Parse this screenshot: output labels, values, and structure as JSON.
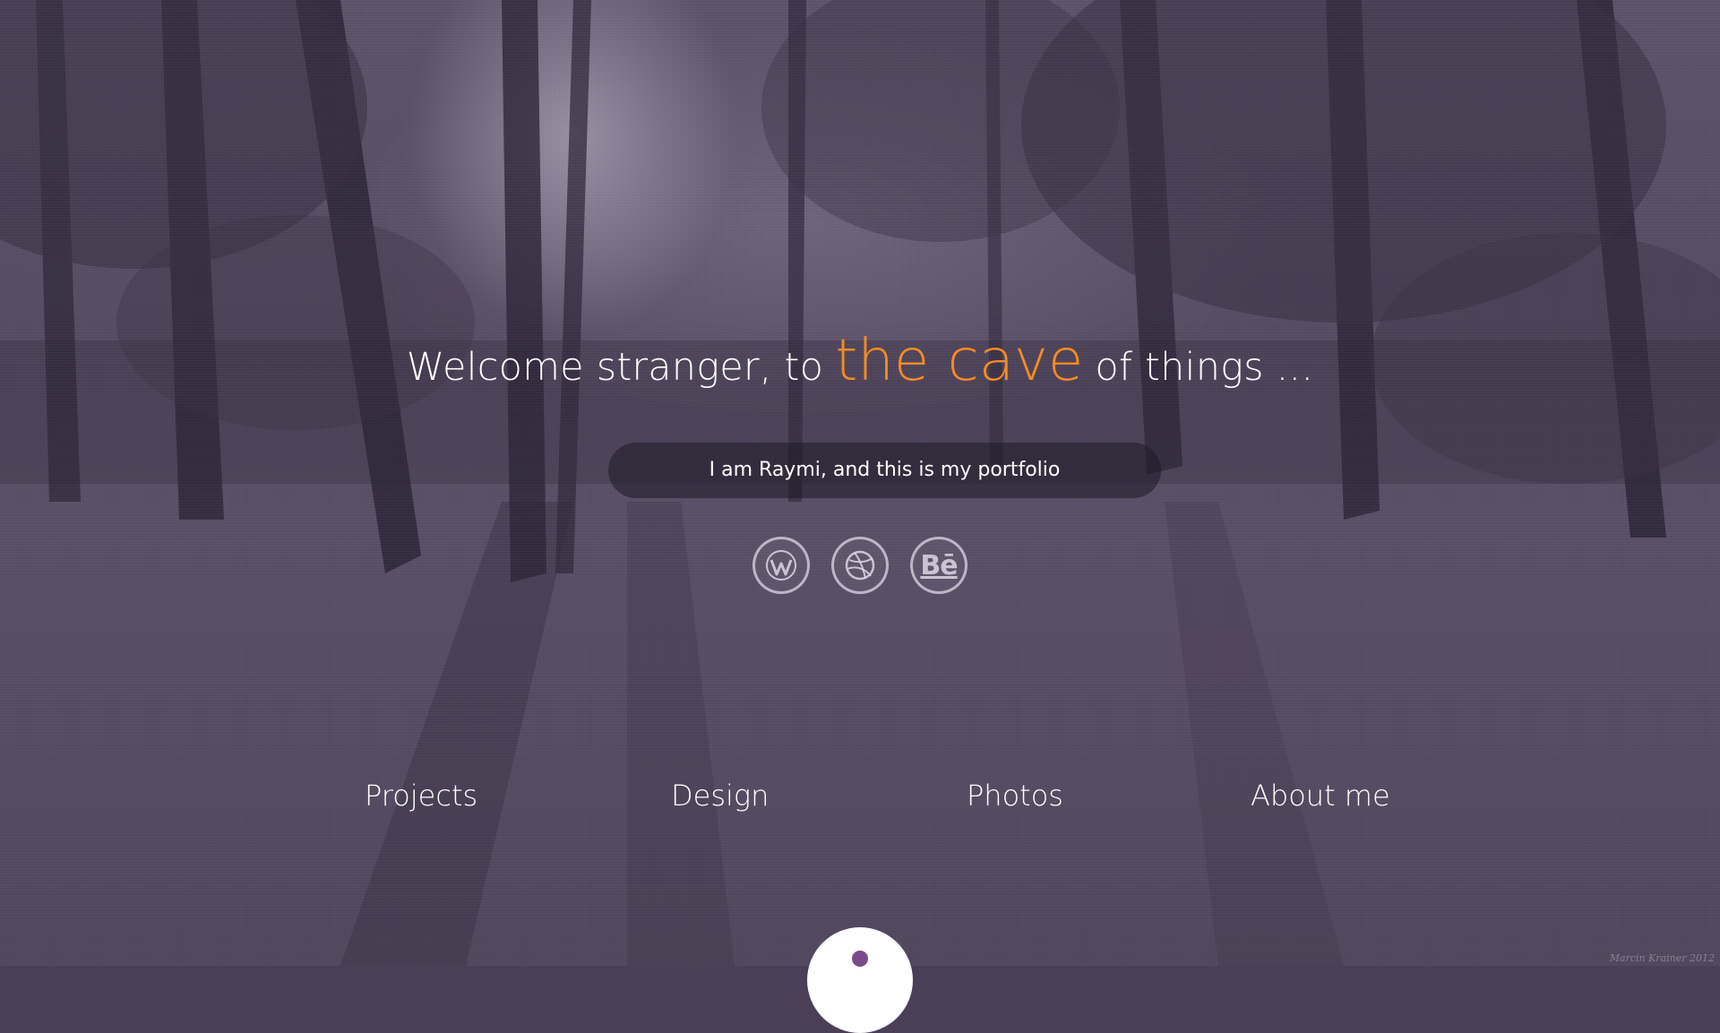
{
  "headline": {
    "before": "Welcome stranger, to",
    "accent": "the cave",
    "after": "of things ..."
  },
  "tagline": "I am Raymi, and this is my portfolio",
  "social_icons": [
    "wordpress-icon",
    "dribbble-icon",
    "behance-icon"
  ],
  "behance_glyph": "Bē",
  "nav": {
    "items": [
      {
        "label": "Projects"
      },
      {
        "label": "Design"
      },
      {
        "label": "Photos"
      },
      {
        "label": "About me"
      }
    ]
  },
  "signature": "Marcin Krainer 2012",
  "colors": {
    "accent": "#f58a25",
    "overlay": "#5a4e66",
    "scroll_dot": "#7a4c8a"
  }
}
